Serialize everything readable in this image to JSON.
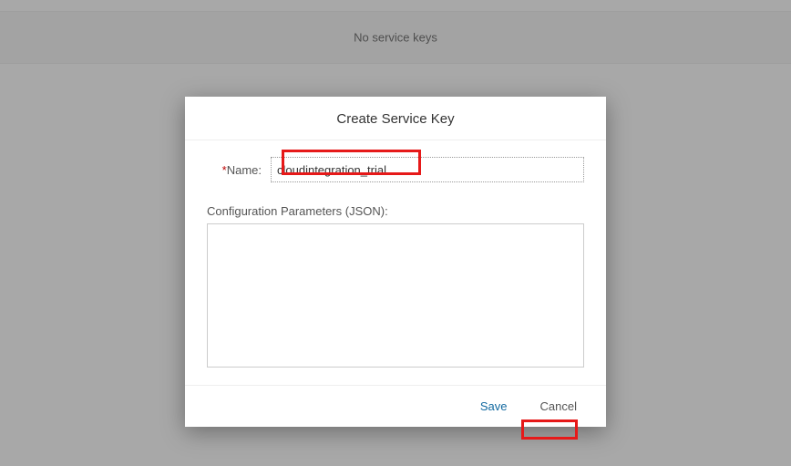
{
  "background": {
    "no_keys_text": "No service keys"
  },
  "dialog": {
    "title": "Create Service Key",
    "name_label": "Name:",
    "name_value": "cloudintegration_trial",
    "config_label": "Configuration Parameters (JSON):",
    "config_value": ""
  },
  "buttons": {
    "save": "Save",
    "cancel": "Cancel"
  }
}
